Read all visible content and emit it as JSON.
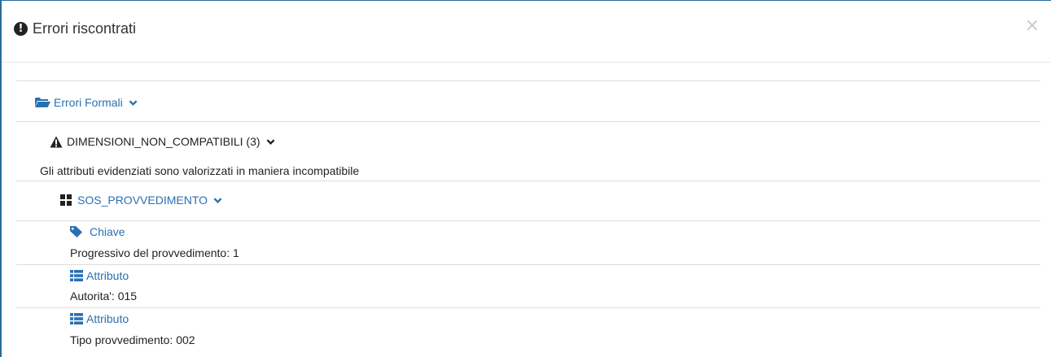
{
  "modal": {
    "title": "Errori riscontrati",
    "close_symbol": "×"
  },
  "tree": {
    "category": {
      "label": "Errori Formali",
      "icon": "folder-open-icon"
    },
    "error": {
      "code": "DIMENSIONI_NON_COMPATIBILI (3)",
      "icon": "warning-icon",
      "description": "Gli attributi evidenziati sono valorizzati in maniera incompatibile"
    },
    "entity": {
      "label": "SOS_PROVVEDIMENTO",
      "icon": "grid-icon"
    },
    "items": [
      {
        "type": "Chiave",
        "icon": "tag-icon",
        "value": "Progressivo del provvedimento: 1"
      },
      {
        "type": "Attributo",
        "icon": "list-icon",
        "value": "Autorita': 015"
      },
      {
        "type": "Attributo",
        "icon": "list-icon",
        "value": "Tipo provvedimento: 002"
      }
    ]
  },
  "colors": {
    "link": "#2a6fb3",
    "border": "#2a6c9b",
    "divider": "#dddddd"
  }
}
